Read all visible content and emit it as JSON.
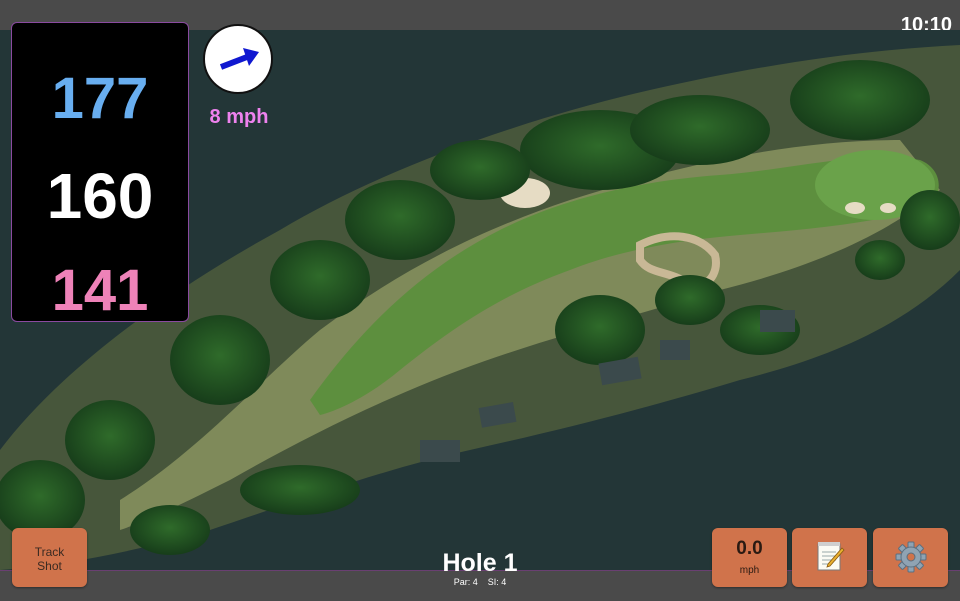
{
  "status": {
    "time": "10:10"
  },
  "yardage": {
    "back": "177",
    "center": "160",
    "front": "141"
  },
  "wind": {
    "speed": "8 mph",
    "icon": "wind-direction-arrow-icon"
  },
  "hole": {
    "title": "Hole 1",
    "par": "Par: 4",
    "si": "SI: 4"
  },
  "buttons": {
    "track_shot": "Track\nShot",
    "speed_value": "0.0",
    "speed_unit": "mph",
    "notes_icon": "notepad-icon",
    "settings_icon": "gear-icon"
  },
  "colors": {
    "back_yardage": "#68aef0",
    "center_yardage": "#ffffff",
    "front_yardage": "#ee82b8",
    "wind_text": "#ee82ee",
    "button": "#d0734b",
    "accent_line": "#8a4aa0"
  }
}
